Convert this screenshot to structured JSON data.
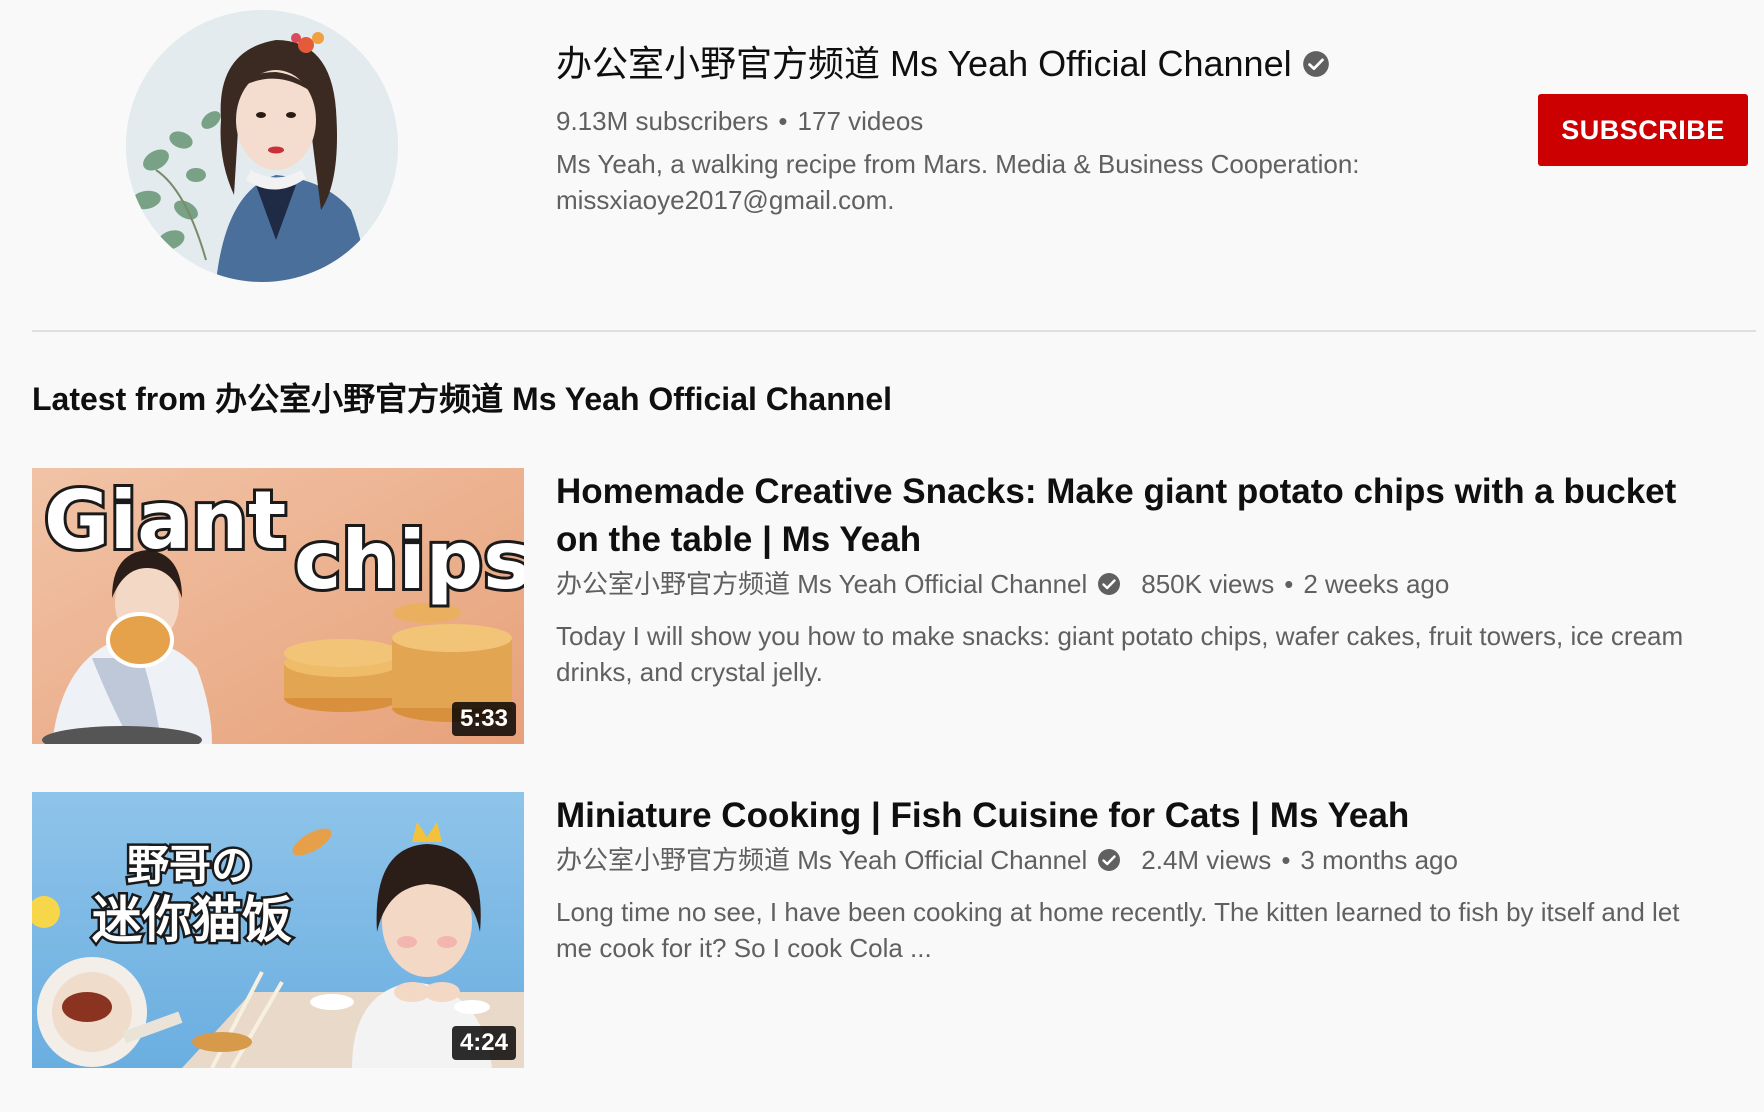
{
  "channel": {
    "name": "办公室小野官方频道 Ms Yeah Official Channel",
    "subscribers": "9.13M subscribers",
    "separator": "•",
    "videos": "177 videos",
    "description": "Ms Yeah, a walking recipe from Mars. Media & Business Cooperation: missxiaoye2017@gmail.com.",
    "subscribe_label": "SUBSCRIBE",
    "subscribe_color": "#cc0000"
  },
  "section": {
    "title": "Latest from 办公室小野官方频道 Ms Yeah Official Channel"
  },
  "videos": [
    {
      "title": "Homemade Creative Snacks: Make giant potato chips with a bucket on the table | Ms Yeah",
      "channel": "办公室小野官方频道 Ms Yeah Official Channel",
      "views": "850K views",
      "separator": "•",
      "age": "2 weeks ago",
      "description": "Today I will show you how to make snacks: giant potato chips, wafer cakes, fruit towers, ice cream drinks, and crystal jelly.",
      "duration": "5:33",
      "thumb_text_1": "Giant",
      "thumb_text_2": "chips"
    },
    {
      "title": "Miniature Cooking | Fish Cuisine for Cats | Ms Yeah",
      "channel": "办公室小野官方频道 Ms Yeah Official Channel",
      "views": "2.4M views",
      "separator": "•",
      "age": "3 months ago",
      "description": "Long time no see, I have been cooking at home recently. The kitten learned to fish by itself and let me cook for it? So I cook Cola ...",
      "duration": "4:24",
      "thumb_text_1": "野哥の",
      "thumb_text_2": "迷你猫饭"
    }
  ]
}
